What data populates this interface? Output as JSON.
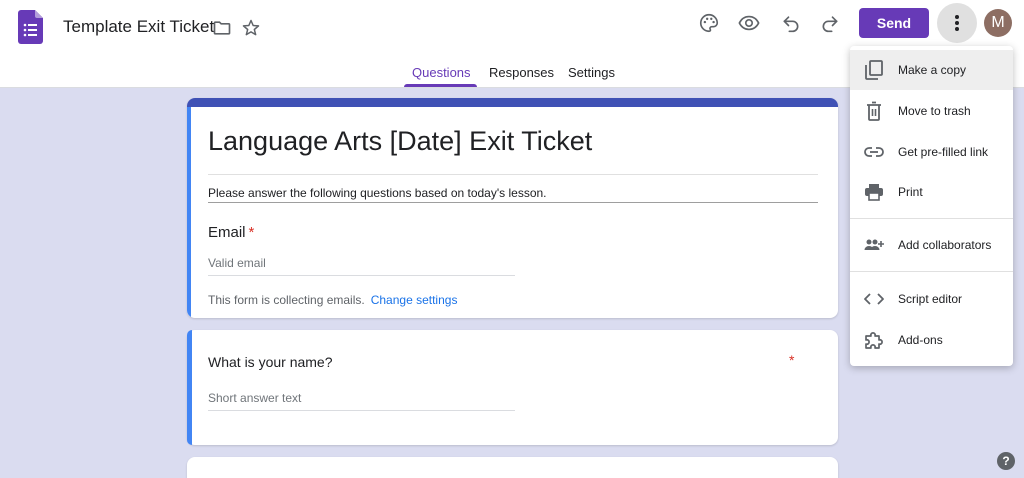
{
  "header": {
    "doc_title": "Template Exit Ticket",
    "send_label": "Send",
    "avatar_initial": "M"
  },
  "tabs": [
    {
      "label": "Questions",
      "active": true
    },
    {
      "label": "Responses",
      "active": false
    },
    {
      "label": "Settings",
      "active": false
    }
  ],
  "form": {
    "title": "Language Arts [Date] Exit Ticket",
    "description": "Please answer the following questions based on today's lesson.",
    "email": {
      "label": "Email",
      "required_mark": "*",
      "placeholder": "Valid email",
      "note": "This form is collecting emails.",
      "change_link": "Change settings"
    },
    "questions": [
      {
        "label": "What is your name?",
        "required_mark": "*",
        "placeholder": "Short answer text"
      }
    ]
  },
  "menu": {
    "items": [
      {
        "label": "Make a copy",
        "icon": "copy-icon"
      },
      {
        "label": "Move to trash",
        "icon": "trash-icon"
      },
      {
        "label": "Get pre-filled link",
        "icon": "link-icon"
      },
      {
        "label": "Print",
        "icon": "print-icon"
      },
      {
        "label": "Add collaborators",
        "icon": "add-people-icon"
      },
      {
        "label": "Script editor",
        "icon": "code-icon"
      },
      {
        "label": "Add-ons",
        "icon": "puzzle-icon"
      }
    ]
  },
  "help_label": "?",
  "colors": {
    "accent": "#673ab7",
    "title_bar": "#3f51b5",
    "canvas_bg": "#dadcf0",
    "required": "#d93025",
    "link": "#1a73e8"
  }
}
